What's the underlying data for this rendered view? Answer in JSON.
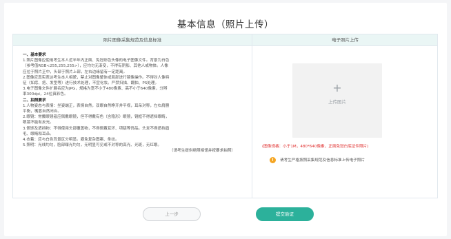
{
  "page": {
    "title": "基本信息（照片上传）"
  },
  "table": {
    "left_header": "照片图像采集规范及信息标准",
    "right_header": "电子照片上传"
  },
  "rules": {
    "section1_title": "一、基本要求",
    "section1_lines": [
      "1.照片图像应使用考生本人近半年内正面、免冠彩色头像的电子图像文件。背景为白色",
      "（参考值RGB<255,255,255>），应均匀无渐变，不得有阴影、其他人或物体。人像",
      "应位于照片正中，头部于照片上部，左右边缘留有一定距离。",
      "2.图像应真实表达考生本人相貌，禁止对图像整体或局部进行镜像操作。不得对人像特",
      "征（如痣、疤、发型等）进行技术处理，不宜化妆。严禁扫描、翻拍、PS处理。",
      "3.电子图像文件扩展名应为JPG，规格为宽不小于480像素、高不小于640像素，分辨",
      "率300dpi，24位真彩色。"
    ],
    "section2_title": "二、拍照要求",
    "section2_lines": [
      "1.人物姿态与表情：坐姿端正，表情自然，双眼自然睁开并平视，耳朵对称，左右肩膀",
      "平衡，嘴唇自然闭合。",
      "2.眼镜：常戴眼镜者应佩戴眼镜，但不得戴有色（含隐形）眼镜，镜框不得遮挡眼睛，",
      "眼镜不能有反光。",
      "3.佩饰及遮挡物：不得使用头部覆盖物，不得佩戴耳环、项链等饰品。头发不得遮挡眉",
      "毛、眼睛和耳朵。",
      "4.衣着：应与白色背景区分明显。避免复杂图案、条纹。",
      "5.照明：光线均匀，脸部曝光均匀，无明显可见或不对称的高光、光斑，无红眼。"
    ],
    "note": "（请考生提供绝照相馆并按要求拍照）"
  },
  "upload": {
    "plus_symbol": "+",
    "label": "上传图片",
    "icon": "plus-icon"
  },
  "spec_text": "(图像规格：小于1M，480*640像素，正面免冠白底证件照片)",
  "tip": {
    "icon": "warning-icon",
    "icon_glyph": "!",
    "text": "请考生严格按照采集规范及信息标准上传电子照片"
  },
  "buttons": {
    "prev_label": "上一步",
    "submit_label": "提交验证"
  },
  "colors": {
    "accent": "#2cb19b",
    "header_bg": "#eaf6f5",
    "warning": "#f5a623",
    "spec_red": "#e0302f"
  }
}
